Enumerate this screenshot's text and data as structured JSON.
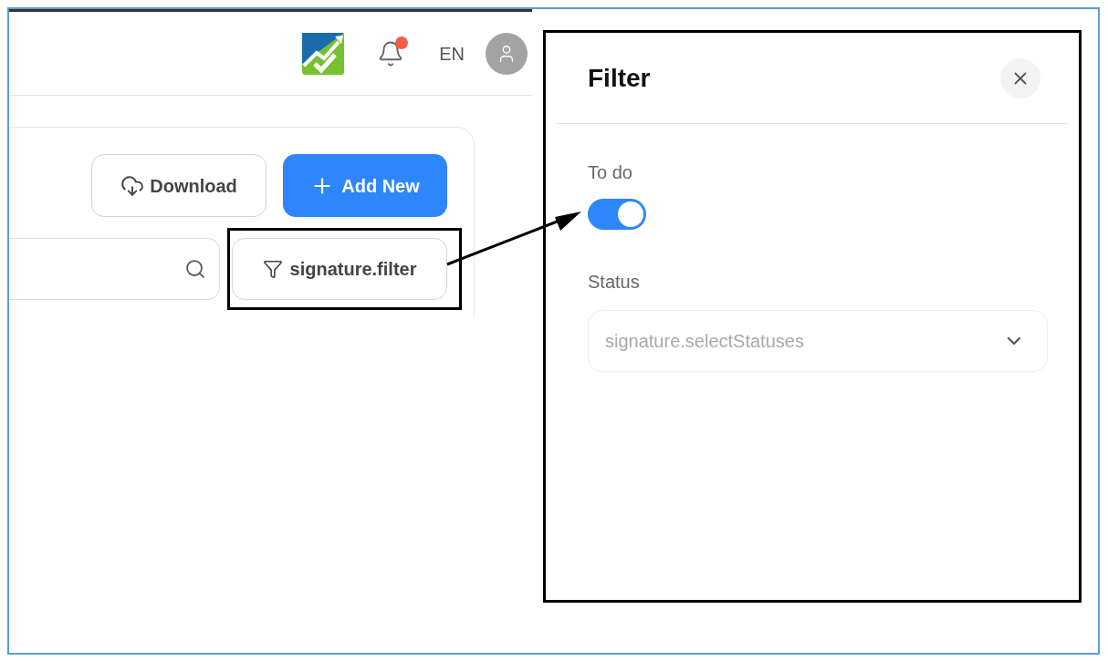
{
  "header": {
    "language": "EN",
    "has_notification": true
  },
  "toolbar": {
    "download_button": "Download",
    "add_button": "Add New",
    "filter_button": "signature.filter"
  },
  "filter_panel": {
    "title": "Filter",
    "toggle": {
      "label": "To do",
      "on": true
    },
    "status_select": {
      "label": "Status",
      "placeholder": "signature.selectStatuses"
    }
  }
}
